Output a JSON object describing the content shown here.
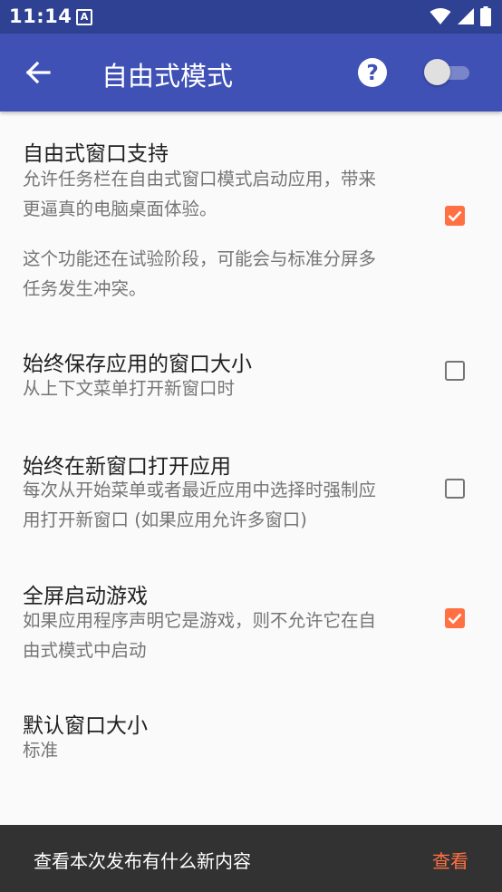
{
  "status_bar": {
    "time": "11:14",
    "notification_icon": "a-icon",
    "icons": [
      "wifi-icon",
      "signal-icon",
      "battery-icon"
    ]
  },
  "app_bar": {
    "title": "自由式模式",
    "back_icon": "arrow-back-icon",
    "help_icon": "help-icon",
    "switch_on": false
  },
  "preferences": [
    {
      "title": "自由式窗口支持",
      "summary_lines": [
        "允许任务栏在自由式窗口模式启动应用，带来",
        "更逼真的电脑桌面体验。"
      ],
      "note_lines": [
        "这个功能还在试验阶段，可能会与标准分屏多",
        "任务发生冲突。"
      ],
      "checked": true
    },
    {
      "title": "始终保存应用的窗口大小",
      "summary_lines": [
        "从上下文菜单打开新窗口时"
      ],
      "checked": false
    },
    {
      "title": "始终在新窗口打开应用",
      "summary_lines": [
        "每次从开始菜单或者最近应用中选择时强制应",
        "用打开新窗口 (如果应用允许多窗口)"
      ],
      "checked": false
    },
    {
      "title": "全屏启动游戏",
      "summary_lines": [
        "如果应用程序声明它是游戏，则不允许它在自",
        "由式模式中启动"
      ],
      "checked": true
    },
    {
      "title": "默认窗口大小",
      "summary_lines": [
        "标准"
      ]
    }
  ],
  "snackbar": {
    "message": "查看本次发布有什么新内容",
    "action": "查看"
  },
  "colors": {
    "status_bar": "#2f4192",
    "app_bar": "#3f51b5",
    "accent": "#ff7043",
    "snackbar": "#323232"
  }
}
